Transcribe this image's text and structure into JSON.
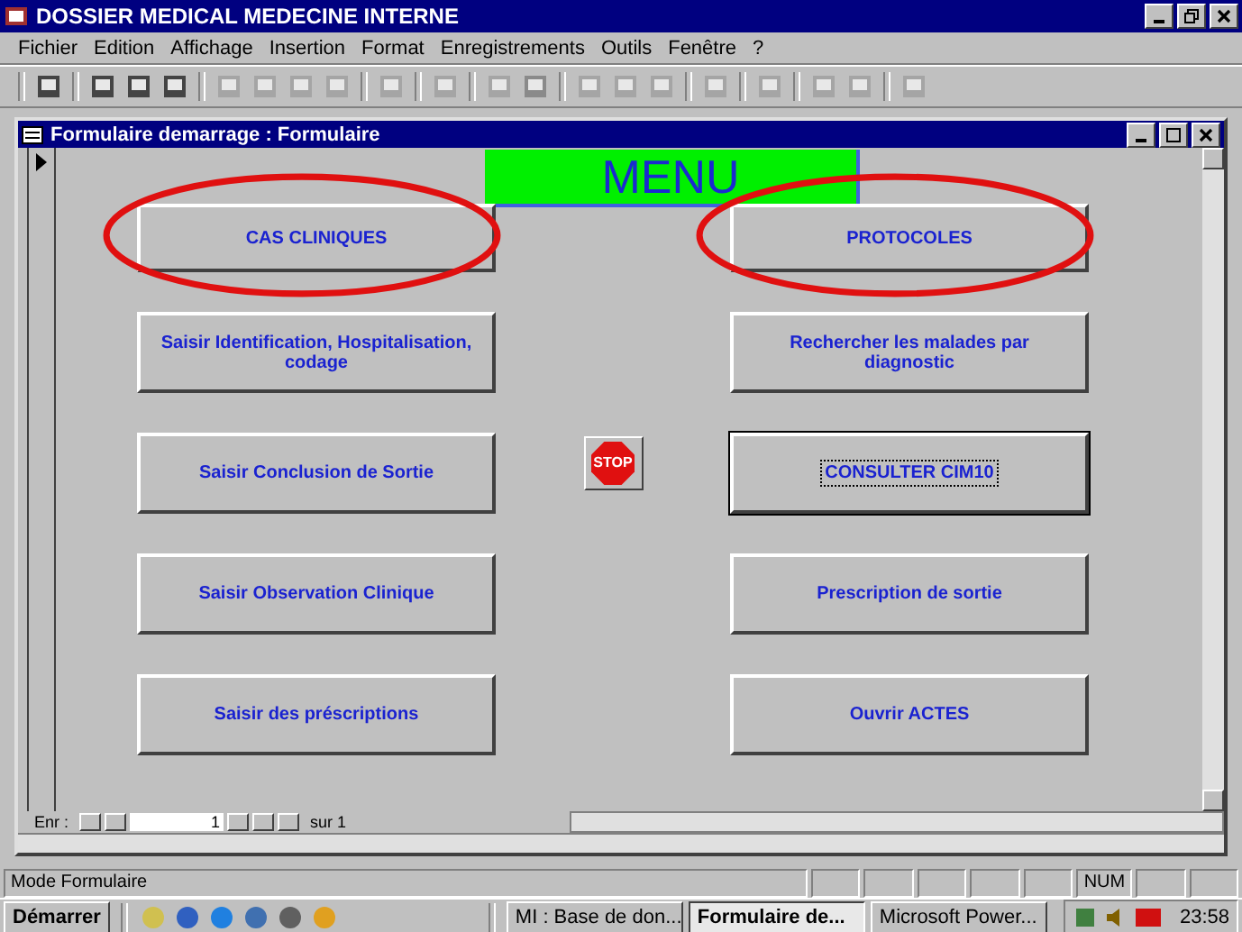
{
  "window": {
    "title": "DOSSIER MEDICAL MEDECINE INTERNE"
  },
  "menu": [
    "Fichier",
    "Edition",
    "Affichage",
    "Insertion",
    "Format",
    "Enregistrements",
    "Outils",
    "Fenêtre",
    "?"
  ],
  "form": {
    "title": "Formulaire demarrage : Formulaire",
    "heading": "MENU",
    "rows": [
      {
        "left": {
          "label": "CAS CLINIQUES",
          "circled": true,
          "selected": false
        },
        "right": {
          "label": "PROTOCOLES",
          "circled": true,
          "selected": false
        }
      },
      {
        "left": {
          "label": "Saisir Identification, Hospitalisation, codage",
          "circled": false,
          "selected": false
        },
        "right": {
          "label": "Rechercher les malades par diagnostic",
          "circled": false,
          "selected": false
        }
      },
      {
        "left": {
          "label": "Saisir Conclusion de Sortie",
          "circled": false,
          "selected": false
        },
        "stop_button": {
          "label": "STOP"
        },
        "right": {
          "label": "CONSULTER CIM10",
          "circled": false,
          "selected": true
        }
      },
      {
        "left": {
          "label": "Saisir Observation Clinique",
          "circled": false,
          "selected": false
        },
        "right": {
          "label": "Prescription de sortie",
          "circled": false,
          "selected": false
        }
      },
      {
        "left": {
          "label": "Saisir des préscriptions",
          "circled": false,
          "selected": false
        },
        "right": {
          "label": "Ouvrir ACTES",
          "circled": false,
          "selected": false
        }
      }
    ],
    "record_nav": {
      "label": "Enr :",
      "value": "1",
      "total": "sur 1"
    }
  },
  "status_bar": {
    "mode": "Mode Formulaire",
    "indicator": "NUM"
  },
  "taskbar": {
    "start": "Démarrer",
    "tasks": [
      {
        "label": "MI : Base de don...",
        "selected": false
      },
      {
        "label": "Formulaire de...",
        "selected": true
      },
      {
        "label": "Microsoft Power...",
        "selected": false
      }
    ],
    "clock": "23:58"
  }
}
